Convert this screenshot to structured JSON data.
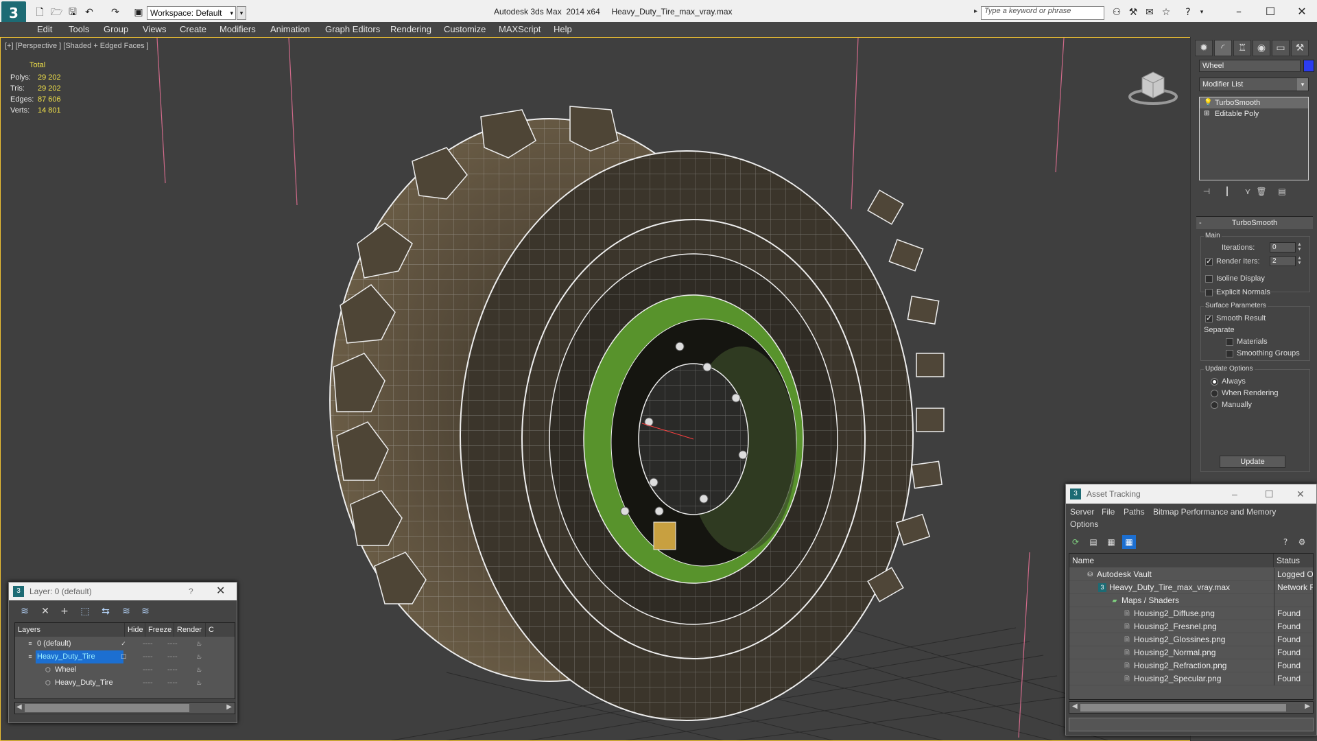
{
  "titlebar": {
    "workspace": "Workspace: Default",
    "app_title": "Autodesk 3ds Max  2014 x64",
    "file_title": "Heavy_Duty_Tire_max_vray.max",
    "search_placeholder": "Type a keyword or phrase"
  },
  "menu": [
    "Edit",
    "Tools",
    "Group",
    "Views",
    "Create",
    "Modifiers",
    "Animation",
    "Graph Editors",
    "Rendering",
    "Customize",
    "MAXScript",
    "Help"
  ],
  "viewport": {
    "label": "[+] [Perspective ] [Shaded + Edged Faces ]",
    "stats": {
      "total_label": "Total",
      "rows": [
        {
          "key": "Polys:",
          "value": "29 202"
        },
        {
          "key": "Tris:",
          "value": "29 202"
        },
        {
          "key": "Edges:",
          "value": "87 606"
        },
        {
          "key": "Verts:",
          "value": "14 801"
        }
      ]
    }
  },
  "command_panel": {
    "object_name": "Wheel",
    "object_color": "#2c3cf0",
    "modifier_list": "Modifier List",
    "stack": [
      "TurboSmooth",
      "Editable Poly"
    ],
    "rollout_title": "TurboSmooth",
    "main_group": "Main",
    "iterations_label": "Iterations:",
    "iterations_value": "0",
    "render_iters_label": "Render Iters:",
    "render_iters_value": "2",
    "isoline_display": "Isoline Display",
    "explicit_normals": "Explicit Normals",
    "surface_group": "Surface Parameters",
    "smooth_result": "Smooth Result",
    "separate_label": "Separate",
    "materials": "Materials",
    "smoothing_groups": "Smoothing Groups",
    "update_group": "Update Options",
    "always": "Always",
    "when_rendering": "When Rendering",
    "manually": "Manually",
    "update_button": "Update"
  },
  "layer_dialog": {
    "title": "Layer: 0 (default)",
    "help": "?",
    "columns": [
      "Layers",
      "Hide",
      "Freeze",
      "Render",
      "C"
    ],
    "rows": [
      {
        "name": "0 (default)"
      },
      {
        "name": "Heavy_Duty_Tire"
      },
      {
        "name": "Wheel"
      },
      {
        "name": "Heavy_Duty_Tire"
      }
    ]
  },
  "asset_dialog": {
    "title": "Asset Tracking",
    "menu": [
      "Server",
      "File",
      "Paths",
      "Bitmap Performance and Memory",
      "Options"
    ],
    "columns": [
      "Name",
      "Status"
    ],
    "rows": [
      {
        "name": "Autodesk Vault",
        "status": "Logged O"
      },
      {
        "name": "Heavy_Duty_Tire_max_vray.max",
        "status": "Network F"
      },
      {
        "name": "Maps / Shaders",
        "status": ""
      },
      {
        "name": "Housing2_Diffuse.png",
        "status": "Found"
      },
      {
        "name": "Housing2_Fresnel.png",
        "status": "Found"
      },
      {
        "name": "Housing2_Glossines.png",
        "status": "Found"
      },
      {
        "name": "Housing2_Normal.png",
        "status": "Found"
      },
      {
        "name": "Housing2_Refraction.png",
        "status": "Found"
      },
      {
        "name": "Housing2_Specular.png",
        "status": "Found"
      }
    ]
  }
}
